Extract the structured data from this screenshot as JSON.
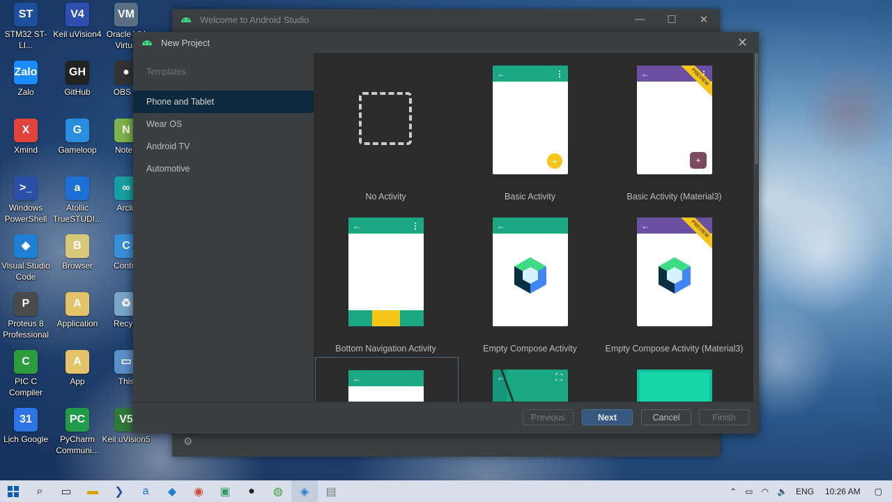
{
  "desktop": {
    "icons": [
      {
        "label": "STM32 ST-LI...",
        "color": "#1e4f9c",
        "glyph": "ST"
      },
      {
        "label": "Keil uVision4",
        "color": "#2f4fb0",
        "glyph": "V4"
      },
      {
        "label": "Oracle VM Virtua",
        "color": "#5a6e86",
        "glyph": "VM"
      },
      {
        "label": "Zalo",
        "color": "#1a8cff",
        "glyph": "Zalo"
      },
      {
        "label": "GitHub",
        "color": "#222222",
        "glyph": "GH"
      },
      {
        "label": "OBS S",
        "color": "#333333",
        "glyph": "●"
      },
      {
        "label": "Xmind",
        "color": "#e0443a",
        "glyph": "X"
      },
      {
        "label": "Gameloop",
        "color": "#2b8de0",
        "glyph": "G"
      },
      {
        "label": "Notep",
        "color": "#7fb24c",
        "glyph": "N"
      },
      {
        "label": "Windows PowerShell",
        "color": "#2b4fa6",
        "glyph": ">_"
      },
      {
        "label": "Atollic TrueSTUDI...",
        "color": "#1d6fd4",
        "glyph": "a"
      },
      {
        "label": "Arclu",
        "color": "#17a0a0",
        "glyph": "∞"
      },
      {
        "label": "Visual Studio Code",
        "color": "#1f7fd4",
        "glyph": "◆"
      },
      {
        "label": "Browser",
        "color": "#d9c97a",
        "glyph": "B"
      },
      {
        "label": "Contro",
        "color": "#3a8fd9",
        "glyph": "C"
      },
      {
        "label": "Proteus 8 Professional",
        "color": "#4a4a4a",
        "glyph": "P"
      },
      {
        "label": "Application",
        "color": "#e2c36a",
        "glyph": "A"
      },
      {
        "label": "Recycl",
        "color": "#7aa6c8",
        "glyph": "♻"
      },
      {
        "label": "PIC C Compiler",
        "color": "#2c9c3c",
        "glyph": "C"
      },
      {
        "label": "App",
        "color": "#e2c36a",
        "glyph": "A"
      },
      {
        "label": "This",
        "color": "#5b8fc9",
        "glyph": "▭"
      },
      {
        "label": "Lịch Google",
        "color": "#2d74e6",
        "glyph": "31"
      },
      {
        "label": "PyCharm Communi...",
        "color": "#1f9b4a",
        "glyph": "PC"
      },
      {
        "label": "Keil uVision5",
        "color": "#2f7a3a",
        "glyph": "V5"
      }
    ]
  },
  "back_window": {
    "title": "Welcome to Android Studio",
    "controls": {
      "minimize": "—",
      "maximize": "☐",
      "close": "✕"
    }
  },
  "dialog": {
    "title": "New Project",
    "close_glyph": "✕",
    "templates_header": "Templates",
    "categories": [
      "Phone and Tablet",
      "Wear OS",
      "Android TV",
      "Automotive"
    ],
    "selected_category": "Phone and Tablet",
    "templates": [
      {
        "label": "No Activity"
      },
      {
        "label": "Basic Activity"
      },
      {
        "label": "Basic Activity (Material3)"
      },
      {
        "label": "Bottom Navigation Activity"
      },
      {
        "label": "Empty Compose Activity"
      },
      {
        "label": "Empty Compose Activity (Material3)"
      }
    ],
    "preview_ribbon": "PREVIEW",
    "buttons": {
      "previous": "Previous",
      "next": "Next",
      "cancel": "Cancel",
      "finish": "Finish"
    },
    "colors": {
      "appbar_green": "#1aa784",
      "appbar_purple": "#6a4fa3",
      "fab_yellow": "#f5c518",
      "selection": "#0d293e"
    }
  },
  "taskbar": {
    "language": "ENG",
    "time": "10:26 AM"
  }
}
